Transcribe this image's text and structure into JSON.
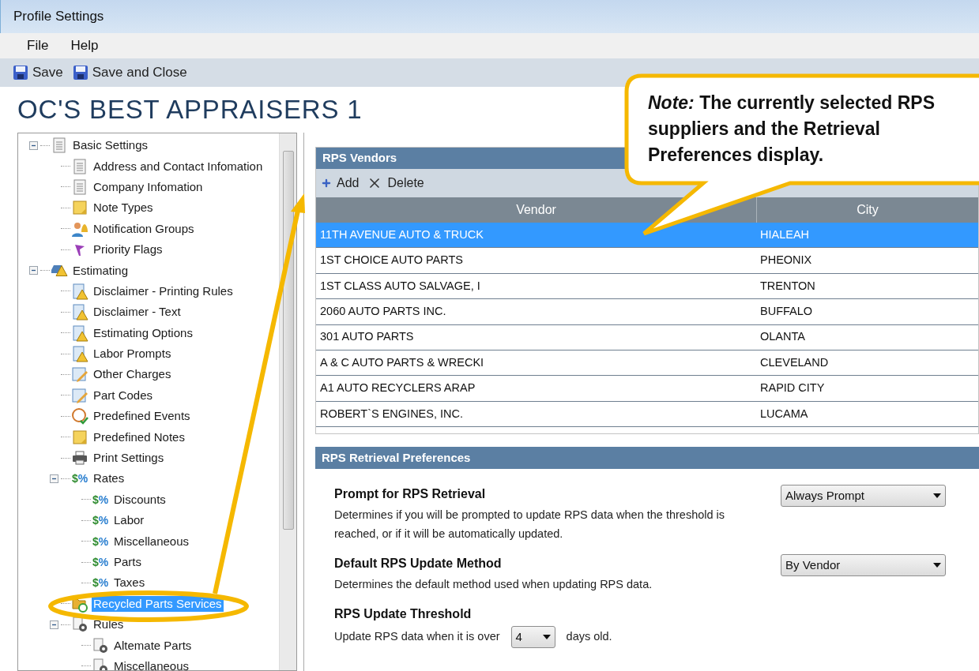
{
  "window": {
    "title": "Profile Settings"
  },
  "menu": [
    "File",
    "Help"
  ],
  "toolbar": [
    {
      "label": "Save"
    },
    {
      "label": "Save and Close"
    }
  ],
  "heading": "OC'S BEST APPRAISERS 1",
  "tree": [
    {
      "label": "Basic Settings",
      "kind": "document",
      "expanded": true,
      "selected": false,
      "children": [
        {
          "label": "Address and Contact Infomation",
          "kind": "document",
          "selected": false
        },
        {
          "label": "Company Infomation",
          "kind": "document",
          "selected": false
        },
        {
          "label": "Note Types",
          "kind": "note",
          "selected": false
        },
        {
          "label": "Notification Groups",
          "kind": "people",
          "selected": false
        },
        {
          "label": "Priority Flags",
          "kind": "flag",
          "selected": false
        }
      ]
    },
    {
      "label": "Estimating",
      "kind": "car",
      "expanded": true,
      "selected": false,
      "children": [
        {
          "label": "Disclaimer - Printing Rules",
          "kind": "warning",
          "selected": false
        },
        {
          "label": "Disclaimer - Text",
          "kind": "warning",
          "selected": false
        },
        {
          "label": "Estimating Options",
          "kind": "warning",
          "selected": false
        },
        {
          "label": "Labor Prompts",
          "kind": "warning",
          "selected": false
        },
        {
          "label": "Other Charges",
          "kind": "edit",
          "selected": false
        },
        {
          "label": "Part Codes",
          "kind": "edit",
          "selected": false
        },
        {
          "label": "Predefined Events",
          "kind": "clock",
          "selected": false
        },
        {
          "label": "Predefined Notes",
          "kind": "note",
          "selected": false
        },
        {
          "label": "Print Settings",
          "kind": "printer",
          "selected": false
        },
        {
          "label": "Rates",
          "kind": "rate",
          "badge": "$%",
          "expanded": true,
          "selected": false,
          "children": [
            {
              "label": "Discounts",
              "kind": "rate",
              "badge": "$%",
              "selected": false
            },
            {
              "label": "Labor",
              "kind": "rate",
              "badge": "$%",
              "selected": false
            },
            {
              "label": "Miscellaneous",
              "kind": "rate",
              "badge": "$%",
              "selected": false
            },
            {
              "label": "Parts",
              "kind": "rate",
              "badge": "$%",
              "selected": false
            },
            {
              "label": "Taxes",
              "kind": "rate",
              "badge": "$%",
              "selected": false
            }
          ]
        },
        {
          "label": "Recycled Parts Services",
          "kind": "recycle",
          "selected": true
        },
        {
          "label": "Rules",
          "kind": "gear",
          "expanded": true,
          "selected": false,
          "children": [
            {
              "label": "Altemate Parts",
              "kind": "gear",
              "selected": false
            },
            {
              "label": "Miscellaneous",
              "kind": "gear",
              "selected": false
            }
          ]
        }
      ]
    }
  ],
  "vendors": {
    "title": "RPS Vendors",
    "actions": [
      {
        "label": "Add",
        "kind": "add"
      },
      {
        "label": "Delete",
        "kind": "delete"
      }
    ],
    "columns": [
      "Vendor",
      "City"
    ],
    "rows": [
      {
        "vendor": "11TH AVENUE AUTO & TRUCK",
        "city": "HIALEAH",
        "selected": true
      },
      {
        "vendor": "1ST CHOICE AUTO PARTS",
        "city": "PHEONIX",
        "selected": false
      },
      {
        "vendor": "1ST CLASS AUTO SALVAGE, I",
        "city": "TRENTON",
        "selected": false
      },
      {
        "vendor": "2060 AUTO PARTS INC.",
        "city": "BUFFALO",
        "selected": false
      },
      {
        "vendor": "301 AUTO PARTS",
        "city": "OLANTA",
        "selected": false
      },
      {
        "vendor": "A & C AUTO PARTS & WRECKI",
        "city": "CLEVELAND",
        "selected": false
      },
      {
        "vendor": "A1 AUTO RECYCLERS  ARAP",
        "city": "RAPID CITY",
        "selected": false
      },
      {
        "vendor": "ROBERT`S ENGINES, INC.",
        "city": "LUCAMA",
        "selected": false
      }
    ]
  },
  "preferences": {
    "title": "RPS Retrieval Preferences",
    "items": [
      {
        "kind": "dropdown",
        "label": "Prompt for RPS Retrieval",
        "description": "Determines if you will be prompted to update RPS data when the threshold is reached, or if it will be automatically updated.",
        "value": "Always Prompt"
      },
      {
        "kind": "dropdown",
        "label": "Default RPS Update Method",
        "description": "Determines the default method used when updating RPS data.",
        "value": "By Vendor"
      },
      {
        "kind": "inline",
        "label": "RPS Update Threshold",
        "before": "Update RPS data when it is over",
        "value": "4",
        "after": "days old."
      }
    ]
  },
  "callout": {
    "text": "*Note:*  The currently selected RPS suppliers and the Retrieval Preferences display."
  }
}
